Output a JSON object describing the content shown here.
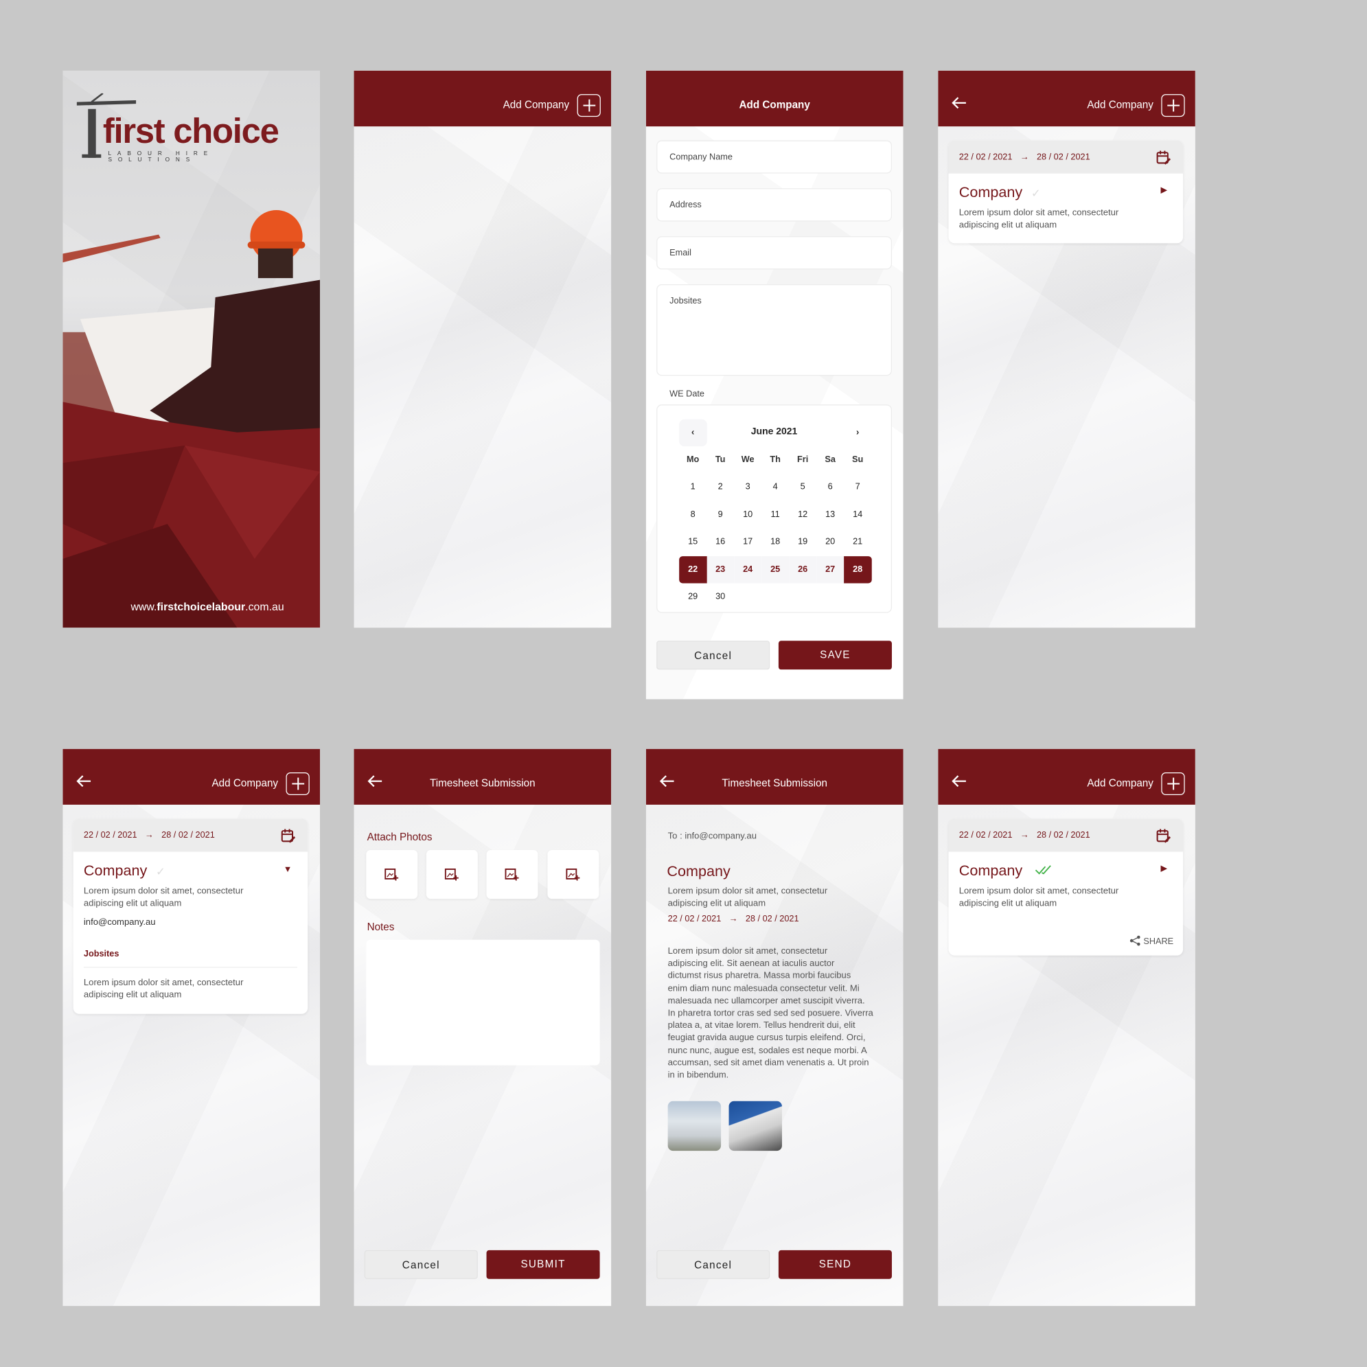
{
  "colors": {
    "brand": "#75161a",
    "background": "#c8c8c8",
    "accent_check": "#3cb043"
  },
  "splash": {
    "logo_main": "first choice",
    "logo_sub": "LABOUR HIRE SOLUTIONS",
    "url_pre": "www.",
    "url_bold": "firstchoicelabour",
    "url_post": ".com.au"
  },
  "add_company_button": "Add Company",
  "form": {
    "title": "Add Company",
    "company_name_placeholder": "Company Name",
    "address_placeholder": "Address",
    "email_placeholder": "Email",
    "jobsites_placeholder": "Jobsites",
    "we_date_label": "WE Date",
    "calendar": {
      "month": "June 2021",
      "weekdays": [
        "Mo",
        "Tu",
        "We",
        "Th",
        "Fri",
        "Sa",
        "Su"
      ],
      "weeks": [
        [
          "1",
          "2",
          "3",
          "4",
          "5",
          "6",
          "7"
        ],
        [
          "8",
          "9",
          "10",
          "11",
          "12",
          "13",
          "14"
        ],
        [
          "15",
          "16",
          "17",
          "18",
          "19",
          "20",
          "21"
        ],
        [
          "22",
          "23",
          "24",
          "25",
          "26",
          "27",
          "28"
        ],
        [
          "29",
          "30"
        ]
      ],
      "range_start": "22",
      "range_end": "28"
    },
    "cancel": "Cancel",
    "save": "SAVE"
  },
  "company_card": {
    "start": "22 / 02 / 2021",
    "end": "28 / 02 / 2021",
    "name": "Company",
    "desc1": "Lorem ipsum dolor sit amet, consectetur",
    "desc2": "adipiscing elit ut aliquam",
    "email": "info@company.au",
    "jobsites_label": "Jobsites",
    "jobsites1": "Lorem ipsum dolor sit amet, consectetur",
    "jobsites2": "adipiscing elit ut aliquam",
    "share": "SHARE"
  },
  "timesheet": {
    "title": "Timesheet Submission",
    "attach_photos": "Attach Photos",
    "notes": "Notes",
    "cancel": "Cancel",
    "submit": "SUBMIT",
    "send": "SEND",
    "to": "To : info@company.au",
    "body": [
      "Lorem ipsum dolor sit amet, consectetur",
      "adipiscing elit. Sit aenean at iaculis auctor",
      "dictumst risus pharetra. Massa morbi faucibus",
      "enim diam nunc malesuada consectetur velit. Mi",
      "malesuada nec ullamcorper amet suscipit viverra.",
      "In pharetra tortor cras sed sed sed posuere. Viverra",
      "platea a, at vitae lorem. Tellus hendrerit dui, elit",
      "feugiat gravida augue cursus turpis eleifend. Orci,",
      "nunc nunc, augue est, sodales est neque morbi. A",
      "accumsan, sed sit amet diam venenatis a. Ut proin",
      "in in bibendum."
    ]
  }
}
